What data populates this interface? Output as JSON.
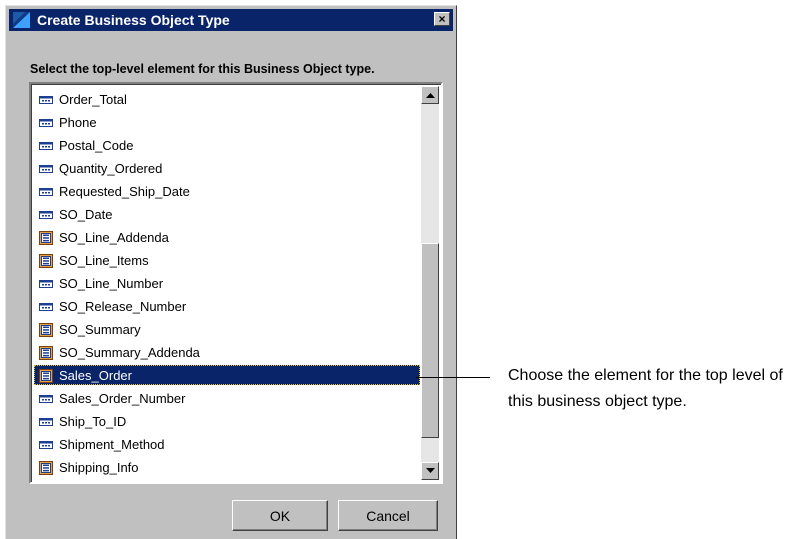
{
  "dialog": {
    "title": "Create Business Object Type",
    "close_label": "×",
    "instruction": "Select the top-level element for this Business Object type.",
    "ok_label": "OK",
    "cancel_label": "Cancel"
  },
  "list": {
    "items": [
      {
        "label": "Order_Total",
        "icon": "attribute-icon"
      },
      {
        "label": "Phone",
        "icon": "attribute-icon"
      },
      {
        "label": "Postal_Code",
        "icon": "attribute-icon"
      },
      {
        "label": "Quantity_Ordered",
        "icon": "attribute-icon"
      },
      {
        "label": "Requested_Ship_Date",
        "icon": "attribute-icon"
      },
      {
        "label": "SO_Date",
        "icon": "attribute-icon"
      },
      {
        "label": "SO_Line_Addenda",
        "icon": "element-icon"
      },
      {
        "label": "SO_Line_Items",
        "icon": "element-icon"
      },
      {
        "label": "SO_Line_Number",
        "icon": "attribute-icon"
      },
      {
        "label": "SO_Release_Number",
        "icon": "attribute-icon"
      },
      {
        "label": "SO_Summary",
        "icon": "element-icon"
      },
      {
        "label": "SO_Summary_Addenda",
        "icon": "element-icon"
      },
      {
        "label": "Sales_Order",
        "icon": "element-icon",
        "selected": true
      },
      {
        "label": "Sales_Order_Number",
        "icon": "attribute-icon"
      },
      {
        "label": "Ship_To_ID",
        "icon": "attribute-icon"
      },
      {
        "label": "Shipment_Method",
        "icon": "attribute-icon"
      },
      {
        "label": "Shipping_Info",
        "icon": "element-icon"
      }
    ]
  },
  "callout": {
    "text": "Choose the element for the top level of this business object type."
  },
  "colors": {
    "titlebar": "#0a246a",
    "selection": "#0a246a",
    "dialog_face": "#c0c0c0"
  }
}
